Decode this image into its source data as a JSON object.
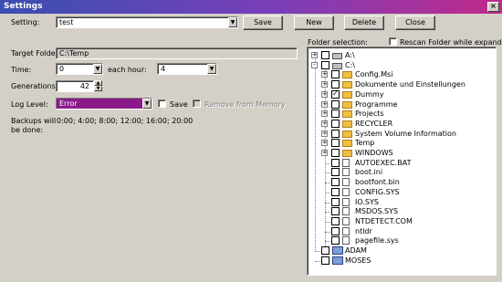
{
  "window": {
    "title": "Settings",
    "close_glyph": "×"
  },
  "setting": {
    "label": "Setting:",
    "value": "test"
  },
  "buttons": {
    "save": "Save",
    "new": "New",
    "delete": "Delete",
    "close": "Close"
  },
  "target_folder": {
    "label": "Target Folder:",
    "value": "C:\\Temp"
  },
  "time": {
    "label": "Time:",
    "value": "0",
    "each_hour_label": "each hour:",
    "each_hour_value": "4"
  },
  "generations": {
    "label": "Generations:",
    "value": "42"
  },
  "log_level": {
    "label": "Log Level:",
    "value": "Error",
    "save_label": "Save",
    "remove_label": "Remove from Memory"
  },
  "backups": {
    "label_line1": "Backups will",
    "label_line2": "be done:",
    "value": "0:00; 4:00; 8:00; 12:00; 16:00; 20:00"
  },
  "folder_selection": {
    "label": "Folder selection:",
    "rescan_label": "Rescan Folder while expanding"
  },
  "tree": [
    {
      "label": "A:\\",
      "kind": "drive",
      "depth": 0,
      "expander": "+",
      "checked": false
    },
    {
      "label": "C:\\",
      "kind": "drive",
      "depth": 0,
      "expander": "-",
      "checked": false
    },
    {
      "label": "Config.Msi",
      "kind": "folder",
      "depth": 1,
      "expander": "+",
      "checked": false
    },
    {
      "label": "Dokumente und Einstellungen",
      "kind": "folder",
      "depth": 1,
      "expander": "+",
      "checked": false
    },
    {
      "label": "Dummy",
      "kind": "folder",
      "depth": 1,
      "expander": "+",
      "checked": true
    },
    {
      "label": "Programme",
      "kind": "folder",
      "depth": 1,
      "expander": "+",
      "checked": false
    },
    {
      "label": "Projects",
      "kind": "folder",
      "depth": 1,
      "expander": "+",
      "checked": false
    },
    {
      "label": "RECYCLER",
      "kind": "folder",
      "depth": 1,
      "expander": "+",
      "checked": false
    },
    {
      "label": "System Volume Information",
      "kind": "folder",
      "depth": 1,
      "expander": "+",
      "checked": false
    },
    {
      "label": "Temp",
      "kind": "folder",
      "depth": 1,
      "expander": "+",
      "checked": false
    },
    {
      "label": "WINDOWS",
      "kind": "folder",
      "depth": 1,
      "expander": "+",
      "checked": false
    },
    {
      "label": "AUTOEXEC.BAT",
      "kind": "file",
      "depth": 1,
      "expander": "",
      "checked": false
    },
    {
      "label": "boot.ini",
      "kind": "file",
      "depth": 1,
      "expander": "",
      "checked": false
    },
    {
      "label": "bootfont.bin",
      "kind": "file",
      "depth": 1,
      "expander": "",
      "checked": false
    },
    {
      "label": "CONFIG.SYS",
      "kind": "file",
      "depth": 1,
      "expander": "",
      "checked": false
    },
    {
      "label": "IO.SYS",
      "kind": "file",
      "depth": 1,
      "expander": "",
      "checked": false
    },
    {
      "label": "MSDOS.SYS",
      "kind": "file",
      "depth": 1,
      "expander": "",
      "checked": false
    },
    {
      "label": "NTDETECT.COM",
      "kind": "file",
      "depth": 1,
      "expander": "",
      "checked": false
    },
    {
      "label": "ntldr",
      "kind": "file",
      "depth": 1,
      "expander": "",
      "checked": false
    },
    {
      "label": "pagefile.sys",
      "kind": "file",
      "depth": 1,
      "expander": "",
      "checked": false
    },
    {
      "label": "ADAM",
      "kind": "network",
      "depth": 0,
      "expander": "",
      "checked": false
    },
    {
      "label": "MOSES",
      "kind": "network",
      "depth": 0,
      "expander": "",
      "checked": false
    }
  ]
}
